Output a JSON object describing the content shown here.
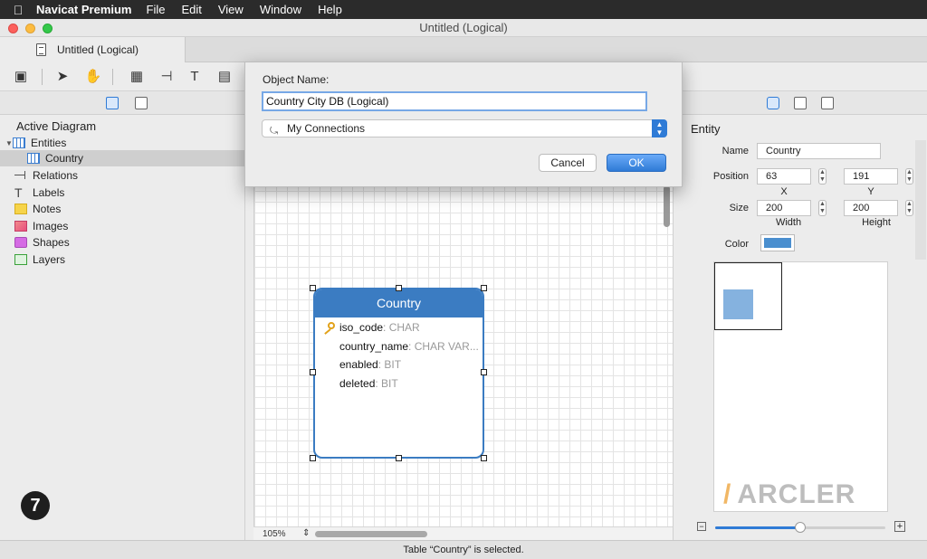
{
  "menubar": {
    "app_name": "Navicat Premium",
    "items": [
      "File",
      "Edit",
      "View",
      "Window",
      "Help"
    ]
  },
  "window": {
    "title": "Untitled (Logical)"
  },
  "tab": {
    "label": "Untitled (Logical)"
  },
  "sidebar": {
    "title": "Active Diagram",
    "items": [
      {
        "label": "Entities",
        "icon": "table-icon"
      },
      {
        "label": "Country",
        "icon": "table-icon"
      },
      {
        "label": "Relations",
        "icon": "relation-icon"
      },
      {
        "label": "Labels",
        "icon": "label-icon"
      },
      {
        "label": "Notes",
        "icon": "note-icon"
      },
      {
        "label": "Images",
        "icon": "image-icon"
      },
      {
        "label": "Shapes",
        "icon": "shape-icon"
      },
      {
        "label": "Layers",
        "icon": "layer-icon"
      }
    ]
  },
  "badge": "7",
  "canvas": {
    "zoom": "105%",
    "entity": {
      "title": "Country",
      "fields": [
        {
          "name": "iso_code",
          "type": ": CHAR",
          "primary_key": true
        },
        {
          "name": "country_name",
          "type": ": CHAR VAR..."
        },
        {
          "name": "enabled",
          "type": ": BIT"
        },
        {
          "name": "deleted",
          "type": ": BIT"
        }
      ]
    }
  },
  "dialog": {
    "label": "Object Name:",
    "name_value": "Country City DB (Logical)",
    "connection": "My Connections",
    "cancel_label": "Cancel",
    "ok_label": "OK"
  },
  "inspector": {
    "title": "Entity",
    "name_label": "Name",
    "name_value": "Country",
    "position_label": "Position",
    "x_value": "63",
    "y_value": "191",
    "x_label": "X",
    "y_label": "Y",
    "size_label": "Size",
    "width_value": "200",
    "height_value": "200",
    "width_label": "Width",
    "height_label": "Height",
    "color_label": "Color",
    "color_value": "#4a8fcf",
    "watermark": "ARCLER",
    "preview_zoom": 0.5
  },
  "status": "Table “Country” is selected."
}
